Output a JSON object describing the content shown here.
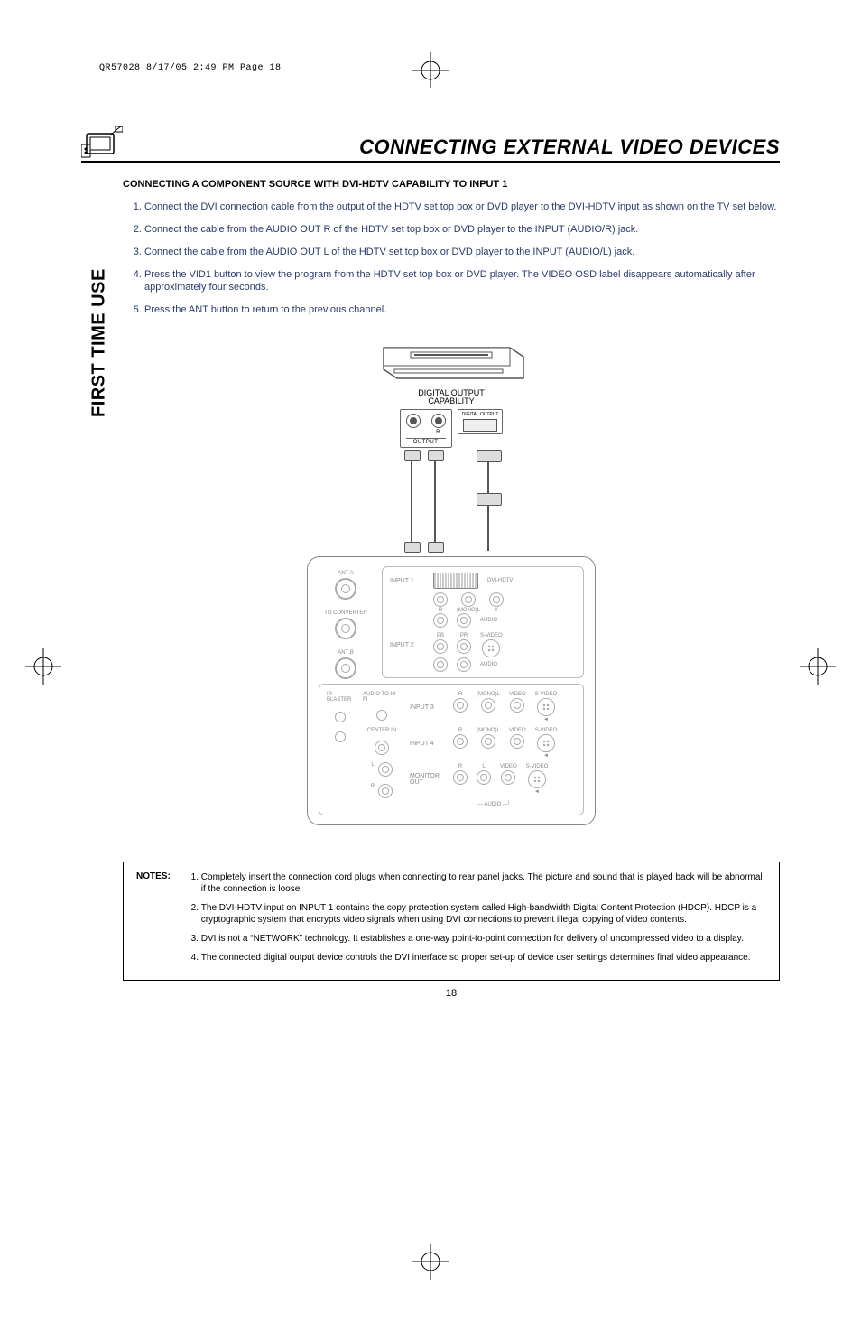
{
  "spine": "QR57028  8/17/05  2:49 PM  Page 18",
  "header": {
    "title": "CONNECTING EXTERNAL VIDEO DEVICES"
  },
  "side_tab": "FIRST TIME USE",
  "subhead": "CONNECTING A COMPONENT SOURCE WITH DVI-HDTV CAPABILITY TO INPUT 1",
  "steps": [
    "Connect the DVI connection cable from the output of the HDTV set top box or DVD player to the DVI-HDTV input as shown on the TV set below.",
    "Connect the cable from the AUDIO OUT R of the HDTV set top box or DVD player to the INPUT (AUDIO/R) jack.",
    "Connect the cable from the AUDIO OUT L of the HDTV set top box or DVD player to the INPUT (AUDIO/L) jack.",
    "Press the VID1 button to view the program from the HDTV set top box or DVD player.  The VIDEO OSD label disappears automatically after approximately four seconds.",
    "Press the ANT button to return to the previous channel."
  ],
  "diagram": {
    "device_caption_line1": "DIGITAL OUTPUT",
    "device_caption_line2": "CAPABILITY",
    "output_label": "OUTPUT",
    "lr": {
      "l": "L",
      "r": "R"
    },
    "digital_output_label": "DIGITAL OUTPUT",
    "panel": {
      "ant_a": "ANT A",
      "to_converter": "TO CONVERTER",
      "ant_b": "ANT B",
      "input1": "INPUT 1",
      "input2": "INPUT 2",
      "input3": "INPUT 3",
      "input4": "INPUT 4",
      "monitor_out": "MONITOR OUT",
      "dvi_hdtv": "DVI-HDTV",
      "mono_l": "(MONO)L",
      "audio": "AUDIO",
      "y": "Y",
      "r": "R",
      "pb": "PB",
      "pr": "PR",
      "svideo": "S-VIDEO",
      "video": "VIDEO",
      "audio_to_hifi": "AUDIO TO HI-FI",
      "center_in": "CENTER IN",
      "l": "L",
      "ir_blaster": "IR BLASTER",
      "audio_footer": "AUDIO"
    }
  },
  "notes_label": "NOTES:",
  "notes": [
    "Completely insert the connection cord plugs when connecting to rear panel jacks.  The picture and sound that is played back will be abnormal if the connection is loose.",
    "The DVI-HDTV input on INPUT 1 contains the copy protection system called High-bandwidth Digital Content Protection (HDCP).  HDCP is a cryptographic system that encrypts video signals when using DVI connections to prevent illegal copying of video contents.",
    "DVI is not a “NETWORK” technology.  It establishes a one-way point-to-point connection for delivery of uncompressed video to a display.",
    "The connected digital output device controls the DVI interface so proper set-up of device user settings determines final video appearance."
  ],
  "page_number": "18"
}
